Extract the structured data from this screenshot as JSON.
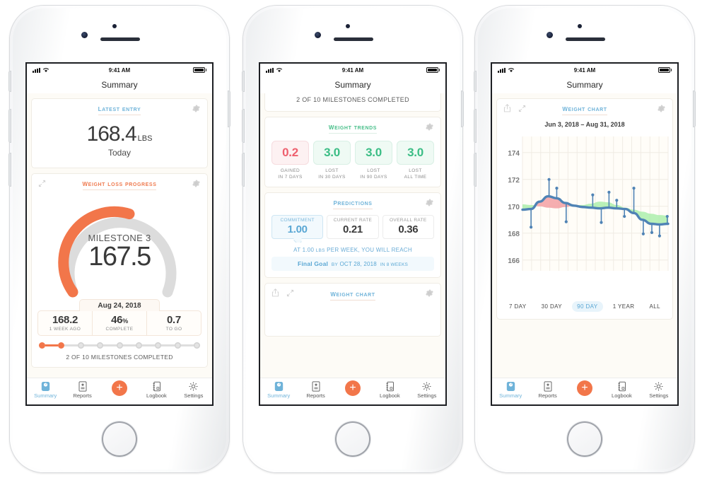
{
  "status_bar": {
    "time": "9:41 AM",
    "signal_icon": "cellular-bars-icon",
    "wifi_icon": "wifi-icon",
    "battery_icon": "battery-icon"
  },
  "nav_title": "Summary",
  "colors": {
    "orange": "#f2764a",
    "blue": "#6fb3d9",
    "green": "#3bbd85",
    "red": "#ee5f6e",
    "line": "#4f83b5"
  },
  "tabbar": {
    "items": [
      {
        "label": "Summary",
        "icon": "scale-icon",
        "active": true
      },
      {
        "label": "Reports",
        "icon": "report-icon",
        "active": false
      },
      {
        "label": "",
        "icon": "plus-icon",
        "active": false
      },
      {
        "label": "Logbook",
        "icon": "logbook-icon",
        "active": false
      },
      {
        "label": "Settings",
        "icon": "gear-icon",
        "active": false
      }
    ],
    "add_label": "+"
  },
  "phone1": {
    "latest_entry": {
      "title": "Latest Entry",
      "value": "168.4",
      "unit": "LBS",
      "sub": "Today",
      "gear_icon": "gear-icon"
    },
    "progress": {
      "title": "Weight Loss Progress",
      "milestone_label": "MILESTONE 3",
      "milestone_value": "167.5",
      "date": "Aug 24, 2018",
      "percent": 46,
      "stats": [
        {
          "value": "168.2",
          "suffix": "",
          "label": "1 WEEK AGO"
        },
        {
          "value": "46",
          "suffix": "%",
          "label": "COMPLETE"
        },
        {
          "value": "0.7",
          "suffix": "",
          "label": "TO GO"
        }
      ],
      "dots_total": 9,
      "dots_done": 2,
      "caption": "2 OF 10 MILESTONES COMPLETED",
      "gear_icon": "gear-icon",
      "expand_icon": "expand-icon"
    }
  },
  "phone2": {
    "milestones_caption": "2 OF 10 MILESTONES COMPLETED",
    "trends": {
      "title": "Weight Trends",
      "gear_icon": "gear-icon",
      "items": [
        {
          "value": "0.2",
          "line1": "GAINED",
          "line2": "IN 7 DAYS",
          "kind": "red"
        },
        {
          "value": "3.0",
          "line1": "LOST",
          "line2": "IN 30 DAYS",
          "kind": "green"
        },
        {
          "value": "3.0",
          "line1": "LOST",
          "line2": "IN 90 DAYS",
          "kind": "green"
        },
        {
          "value": "3.0",
          "line1": "LOST",
          "line2": "ALL TIME",
          "kind": "green"
        }
      ]
    },
    "predictions": {
      "title": "Predictions",
      "gear_icon": "gear-icon",
      "items": [
        {
          "label": "COMMITMENT",
          "value": "1.00",
          "selected": true
        },
        {
          "label": "CURRENT RATE",
          "value": "0.21",
          "selected": false
        },
        {
          "label": "OVERALL RATE",
          "value": "0.36",
          "selected": false
        }
      ],
      "sentence_pre": "AT 1.00 ",
      "sentence_unit": "LBS",
      "sentence_post": " PER WEEK, YOU WILL REACH",
      "goal_name": "Final Goal",
      "goal_by": "BY",
      "goal_date": "OCT 28, 2018",
      "goal_in": "IN 8 WEEKS"
    },
    "chart_card": {
      "title": "Weight Chart",
      "share_icon": "share-icon",
      "expand_icon": "expand-icon",
      "gear_icon": "gear-icon"
    }
  },
  "phone3": {
    "chart_card": {
      "title": "Weight Chart",
      "date_range": "Jun 3, 2018 – Aug 31, 2018",
      "share_icon": "share-icon",
      "expand_icon": "expand-icon",
      "gear_icon": "gear-icon"
    },
    "ranges": [
      {
        "label": "7 DAY",
        "active": false
      },
      {
        "label": "30 DAY",
        "active": false
      },
      {
        "label": "90 DAY",
        "active": true
      },
      {
        "label": "1 YEAR",
        "active": false
      },
      {
        "label": "ALL",
        "active": false
      }
    ]
  },
  "chart_data": {
    "type": "line",
    "title": "Weight Chart",
    "subtitle": "Jun 3, 2018 – Aug 31, 2018",
    "xlabel": "",
    "ylabel": "",
    "ylim": [
      165.2,
      175.2
    ],
    "yticks": [
      174,
      172,
      170,
      168,
      166
    ],
    "grid": true,
    "legend": false,
    "x_range": [
      "Jun 3, 2018",
      "Aug 31, 2018"
    ],
    "series": [
      {
        "name": "Trend",
        "type": "line",
        "color": "#4f83b5",
        "values": [
          169.75,
          169.8,
          170.35,
          170.75,
          170.6,
          170.25,
          170.05,
          169.95,
          169.9,
          169.85,
          169.9,
          169.85,
          169.8,
          169.5,
          169.0,
          168.7,
          168.65,
          168.7
        ]
      },
      {
        "name": "Baseline",
        "type": "line",
        "color": "#cfd8e0",
        "values": [
          170.15,
          170.1,
          170.0,
          169.9,
          169.85,
          169.95,
          170.05,
          170.1,
          170.2,
          170.35,
          170.3,
          170.1,
          169.9,
          169.75,
          169.6,
          169.45,
          169.35,
          169.3
        ]
      },
      {
        "name": "Measurements",
        "type": "scatter",
        "color": "#4f83b5",
        "points": [
          {
            "x": 1.0,
            "y": 168.45
          },
          {
            "x": 3.1,
            "y": 172.0
          },
          {
            "x": 4.0,
            "y": 171.35
          },
          {
            "x": 5.1,
            "y": 168.85
          },
          {
            "x": 8.2,
            "y": 170.85
          },
          {
            "x": 9.2,
            "y": 168.8
          },
          {
            "x": 10.1,
            "y": 171.05
          },
          {
            "x": 11.0,
            "y": 170.45
          },
          {
            "x": 11.9,
            "y": 169.25
          },
          {
            "x": 13.0,
            "y": 171.35
          },
          {
            "x": 14.1,
            "y": 167.95
          },
          {
            "x": 15.1,
            "y": 168.05
          },
          {
            "x": 16.0,
            "y": 167.8
          },
          {
            "x": 16.9,
            "y": 169.25
          }
        ]
      }
    ],
    "bands": [
      {
        "name": "above-baseline",
        "color": "#f3a0a3",
        "label": "gain"
      },
      {
        "name": "below-baseline",
        "color": "#a8eda8",
        "label": "loss"
      }
    ]
  }
}
